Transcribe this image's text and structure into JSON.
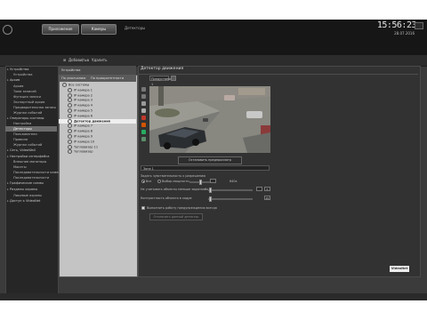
{
  "top_bar": {
    "tab_1": "Приложение",
    "tab_2": "Камеры",
    "section_label": "Детекторы",
    "time": "15:56:23",
    "date": "28.07.2016"
  },
  "strip": {
    "add_label": "Добавить",
    "delete_label": "Удалить"
  },
  "left_tree": [
    {
      "label": "Устройства",
      "kind": "grp"
    },
    {
      "label": "Устройства",
      "kind": "sub"
    },
    {
      "label": "Архив",
      "kind": "grp"
    },
    {
      "label": "Архив",
      "kind": "sub"
    },
    {
      "label": "Тома записей",
      "kind": "sub"
    },
    {
      "label": "Функция записи",
      "kind": "sub"
    },
    {
      "label": "Экспортный архив",
      "kind": "sub"
    },
    {
      "label": "Предварительная запись",
      "kind": "sub"
    },
    {
      "label": "Журнал событий",
      "kind": "sub"
    },
    {
      "label": "Операторы системы",
      "kind": "grp"
    },
    {
      "label": "Настройки",
      "kind": "sub"
    },
    {
      "label": "Детекторы",
      "kind": "sel"
    },
    {
      "label": "Пользователи",
      "kind": "sub"
    },
    {
      "label": "Правила",
      "kind": "sub"
    },
    {
      "label": "Журнал событий",
      "kind": "sub"
    },
    {
      "label": "Сеть, VideoWall",
      "kind": "grp"
    },
    {
      "label": "Настройки интерфейса",
      "kind": "grp"
    },
    {
      "label": "Внешние мониторы",
      "kind": "sub"
    },
    {
      "label": "Макеты",
      "kind": "sub"
    },
    {
      "label": "Последовательности камер",
      "kind": "sub"
    },
    {
      "label": "Последовательности",
      "kind": "sub"
    },
    {
      "label": "Графические схемы",
      "kind": "grp"
    },
    {
      "label": "Разделы охраны",
      "kind": "grp"
    },
    {
      "label": "Лицевые охраны",
      "kind": "sub"
    },
    {
      "label": "Доступ к VideoNet",
      "kind": "grp"
    }
  ],
  "camera_list": {
    "header": "Устройства",
    "filter_1": "По умолчанию",
    "filter_2": "По приоритетности",
    "items": [
      {
        "label": "Все системы",
        "kind": "root"
      },
      {
        "label": "IP камера 1",
        "kind": "item"
      },
      {
        "label": "IP камера 2",
        "kind": "item"
      },
      {
        "label": "IP камера 3",
        "kind": "item"
      },
      {
        "label": "IP камера 4",
        "kind": "item"
      },
      {
        "label": "IP камера 5",
        "kind": "item"
      },
      {
        "label": "IP камера 6",
        "kind": "item"
      },
      {
        "label": "Детектор движения",
        "kind": "sel"
      },
      {
        "label": "IP камера 7",
        "kind": "item"
      },
      {
        "label": "IP камера 8",
        "kind": "item"
      },
      {
        "label": "IP камера 9",
        "kind": "item"
      },
      {
        "label": "IP камера 10",
        "kind": "item"
      },
      {
        "label": "Тепловизор 11",
        "kind": "item"
      },
      {
        "label": "Тепловизор",
        "kind": "item"
      }
    ]
  },
  "detector": {
    "title": "Детектор движения",
    "preset": "Предустановка 1",
    "preview_button": "Остановить предпросмотр",
    "zone_name": "Зона 1",
    "sensitivity_label": "Задать чувствительность к разрешению",
    "radio_1": "Все",
    "radio_2": "Выбор мощности",
    "object_label": "Не учитывать объекты меньше заданного",
    "contrast_label": "Контрастность объекта в кадре",
    "resolution_value": "640x",
    "object_min": "0",
    "object_max": "0",
    "contrast_value": "20",
    "checkbox_label": "Выполнить работу предупреждения всегда",
    "grey_button": "Отключить данный детектор",
    "sensitivity_level": 0.42,
    "object_level": 0.05,
    "contrast_level": 0.05
  },
  "watermark": "VideoNet"
}
